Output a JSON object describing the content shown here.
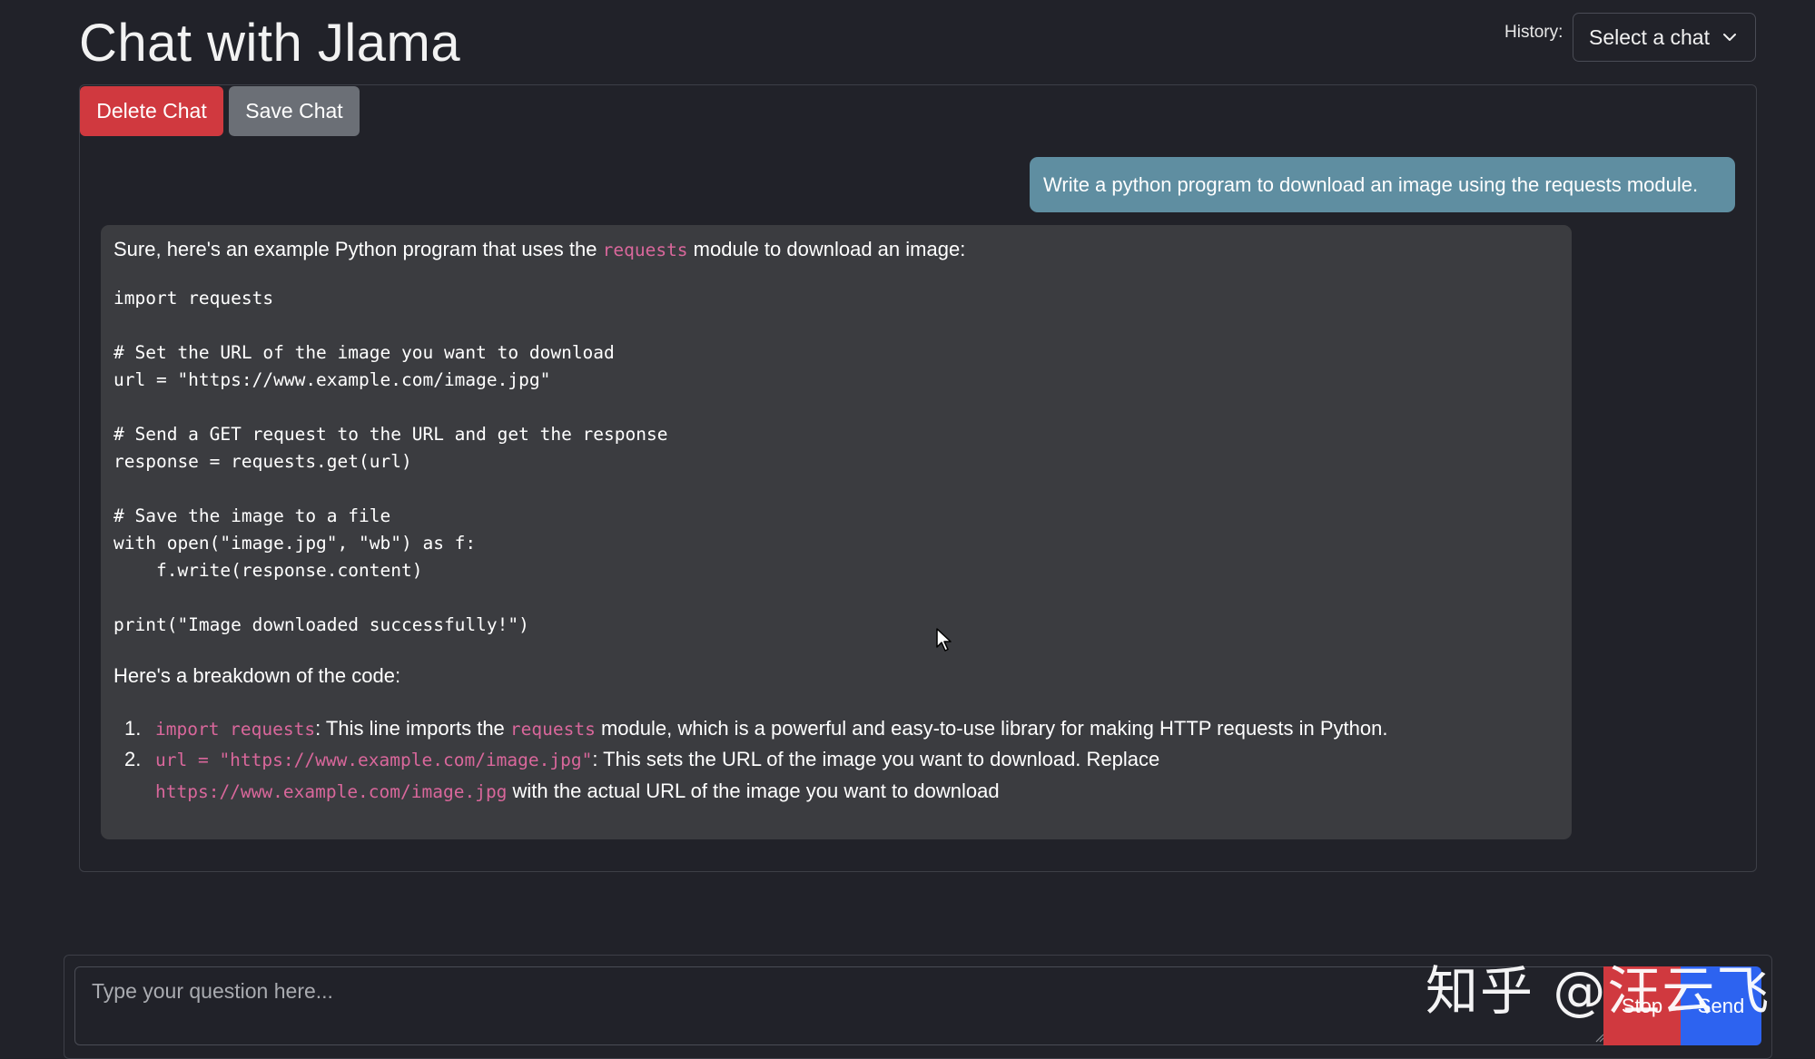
{
  "header": {
    "title": "Chat with Jlama",
    "history_label": "History:",
    "history_select_value": "Select a chat"
  },
  "toolbar": {
    "delete_label": "Delete Chat",
    "save_label": "Save Chat"
  },
  "messages": {
    "user": "Write a python program to download an image using the requests module.",
    "bot": {
      "intro_before": "Sure, here's an example Python program that uses the ",
      "intro_code": "requests",
      "intro_after": " module to download an image:",
      "code_lines": [
        "import requests",
        "",
        "# Set the URL of the image you want to download",
        "url = \"https://www.example.com/image.jpg\"",
        "",
        "# Send a GET request to the URL and get the response",
        "response = requests.get(url)",
        "",
        "# Save the image to a file",
        "with open(\"image.jpg\", \"wb\") as f:",
        "    f.write(response.content)",
        "",
        "print(\"Image downloaded successfully!\")"
      ],
      "breakdown": "Here's a breakdown of the code:",
      "list": [
        {
          "num": "1.",
          "code": "import requests",
          "text_a": ": This line imports the ",
          "code_b": "requests",
          "text_b": " module, which is a powerful and easy-to-use library for making HTTP requests in Python."
        },
        {
          "num": "2.",
          "code": "url = \"https://www.example.com/image.jpg\"",
          "text_a": ": This sets the URL of the image you want to download. Replace",
          "code_b": "https://www.example.com/image.jpg",
          "text_b": " with the actual URL of the image you want to download"
        }
      ]
    }
  },
  "input": {
    "placeholder": "Type your question here...",
    "stop_label": "Stop",
    "send_label": "Send"
  },
  "watermark": "知乎 @汪云飞",
  "colors": {
    "background": "#212229",
    "delete": "#d0393f",
    "save": "#6b6f76",
    "user_bubble": "#5f8ea1",
    "bot_bubble": "#3b3c40",
    "inline_code": "#d9679b",
    "send": "#2d63f0"
  },
  "icons": {
    "history_dropdown": "chevron-down-icon",
    "pointer": "mouse-cursor-icon"
  }
}
